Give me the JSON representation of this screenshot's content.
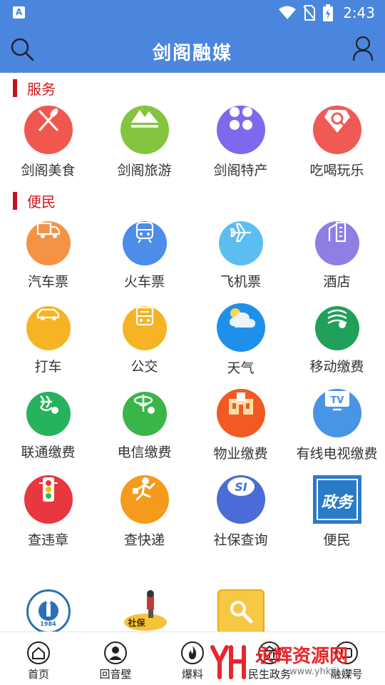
{
  "status_bar": {
    "app_icon_letter": "A",
    "time": "2:43"
  },
  "header": {
    "title": "剑阁融媒"
  },
  "sections": [
    {
      "title": "服务",
      "items": [
        {
          "label": "剑阁美食",
          "icon": "fork-knife-icon",
          "color": "#f0584f"
        },
        {
          "label": "剑阁旅游",
          "icon": "mountain-icon",
          "color": "#84c43f"
        },
        {
          "label": "剑阁特产",
          "icon": "four-dots-icon",
          "color": "#7c69ec"
        },
        {
          "label": "吃喝玩乐",
          "icon": "gem-search-icon",
          "color": "#f05a55"
        }
      ]
    },
    {
      "title": "便民",
      "items": [
        {
          "label": "汽车票",
          "icon": "truck-icon",
          "color": "#f59243"
        },
        {
          "label": "火车票",
          "icon": "train-icon",
          "color": "#4b8de8"
        },
        {
          "label": "飞机票",
          "icon": "plane-icon",
          "color": "#5cbef0"
        },
        {
          "label": "酒店",
          "icon": "building-icon",
          "color": "#8e7fe3"
        },
        {
          "label": "打车",
          "icon": "car-icon",
          "color": "#f6b424"
        },
        {
          "label": "公交",
          "icon": "bus-icon",
          "color": "#f6b424"
        },
        {
          "label": "天气",
          "icon": "weather-icon",
          "color": "#1e90ea"
        },
        {
          "label": "移动缴费",
          "icon": "china-mobile-icon",
          "color": "#20a05a"
        },
        {
          "label": "联通缴费",
          "icon": "china-unicom-icon",
          "color": "#27b25e"
        },
        {
          "label": "电信缴费",
          "icon": "china-telecom-icon",
          "color": "#3ab54a"
        },
        {
          "label": "物业缴费",
          "icon": "property-building-icon",
          "color": "#f15a22"
        },
        {
          "label": "有线电视缴费",
          "icon": "tv-icon",
          "color": "#4a94e8"
        },
        {
          "label": "查违章",
          "icon": "traffic-light-icon",
          "color": "#e8373f"
        },
        {
          "label": "查快递",
          "icon": "courier-icon",
          "color": "#f59a1d"
        },
        {
          "label": "社保查询",
          "icon": "social-security-icon",
          "color": "#4a6cd6"
        },
        {
          "label": "便民",
          "icon": "government-affairs-icon",
          "color": "#2a7bc7",
          "badge_text": "政务"
        }
      ]
    }
  ],
  "partial_row": [
    {
      "icon": "school-logo-icon",
      "logo_text": "1984"
    },
    {
      "icon": "social-security-cartoon-icon",
      "logo_text": "社保"
    },
    {
      "icon": "search-folder-icon"
    }
  ],
  "bottom_nav": [
    {
      "label": "首页",
      "icon": "home-icon"
    },
    {
      "label": "回音壁",
      "icon": "person-icon"
    },
    {
      "label": "爆料",
      "icon": "flame-icon"
    },
    {
      "label": "民生政务",
      "icon": "government-icon"
    },
    {
      "label": "融媒号",
      "icon": "media-icon"
    }
  ],
  "watermark": {
    "brand": "永辉资源网",
    "url": "www.yhkjjj.cn"
  },
  "colors": {
    "primary": "#4a86de",
    "section_accent": "#c9111d"
  }
}
